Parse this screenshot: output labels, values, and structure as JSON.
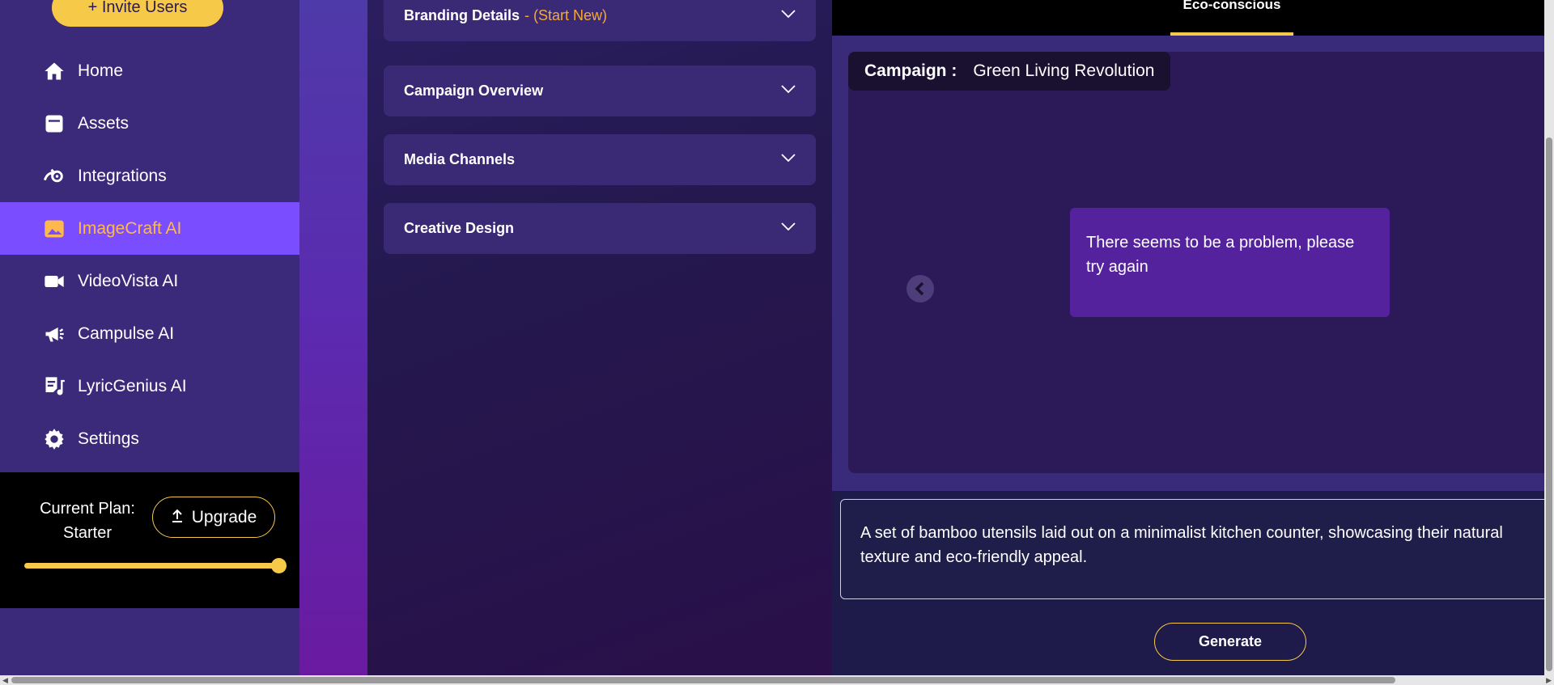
{
  "sidebar": {
    "invite_label": "+ Invite Users",
    "items": [
      {
        "label": "Home",
        "icon": "home-icon"
      },
      {
        "label": "Assets",
        "icon": "assets-icon"
      },
      {
        "label": "Integrations",
        "icon": "integrations-icon"
      },
      {
        "label": "ImageCraft AI",
        "icon": "image-icon",
        "active": true
      },
      {
        "label": "VideoVista AI",
        "icon": "video-icon"
      },
      {
        "label": "Campulse AI",
        "icon": "megaphone-icon"
      },
      {
        "label": "LyricGenius AI",
        "icon": "lyrics-icon"
      },
      {
        "label": "Settings",
        "icon": "gear-icon"
      }
    ],
    "plan": {
      "label_line1": "Current Plan:",
      "label_line2": "Starter",
      "upgrade_label": "Upgrade",
      "usage_fraction": 1.0
    }
  },
  "accordion": {
    "sections": [
      {
        "title": "Branding Details",
        "accent": "- (Start New)"
      },
      {
        "title": "Campaign Overview",
        "accent": ""
      },
      {
        "title": "Media Channels",
        "accent": ""
      },
      {
        "title": "Creative Design",
        "accent": ""
      }
    ]
  },
  "preview": {
    "active_tab": "Eco-conscious",
    "campaign_label": "Campaign :",
    "campaign_name": "Green Living Revolution",
    "error_message": "There seems to be a problem, please try again",
    "prompt_text": "A set of bamboo utensils laid out on a minimalist kitchen counter, showcasing their natural texture and eco-friendly appeal.",
    "generate_label": "Generate"
  },
  "colors": {
    "accent_yellow": "#f7c948",
    "active_purple": "#7a4dff",
    "active_text": "#ffb84d",
    "sidebar_bg": "#3b2a7a"
  }
}
